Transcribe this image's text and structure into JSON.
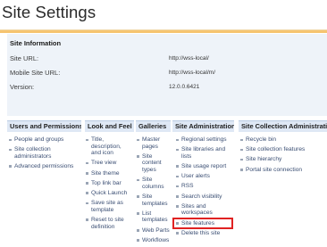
{
  "page": {
    "title": "Site Settings"
  },
  "site_information": {
    "header": "Site Information",
    "rows": [
      {
        "label": "Site URL:",
        "value": "http://wss-local/"
      },
      {
        "label": "Mobile Site URL:",
        "value": "http://wss-local/m/"
      },
      {
        "label": "Version:",
        "value": "12.0.0.6421"
      }
    ]
  },
  "columns": [
    {
      "header": "Users and Permissions",
      "items": [
        "People and groups",
        "Site collection administrators",
        "Advanced permissions"
      ]
    },
    {
      "header": "Look and Feel",
      "items": [
        "Title, description, and icon",
        "Tree view",
        "Site theme",
        "Top link bar",
        "Quick Launch",
        "Save site as template",
        "Reset to site definition"
      ]
    },
    {
      "header": "Galleries",
      "items": [
        "Master pages",
        "Site content types",
        "Site columns",
        "Site templates",
        "List templates",
        "Web Parts",
        "Workflows"
      ]
    },
    {
      "header": "Site Administration",
      "items": [
        "Regional settings",
        "Site libraries and lists",
        "Site usage report",
        "User alerts",
        "RSS",
        "Search visibility",
        "Sites and workspaces",
        "Site features",
        "Delete this site"
      ]
    },
    {
      "header": "Site Collection Administration",
      "items": [
        "Recycle bin",
        "Site collection features",
        "Site hierarchy",
        "Portal site connection"
      ]
    }
  ]
}
